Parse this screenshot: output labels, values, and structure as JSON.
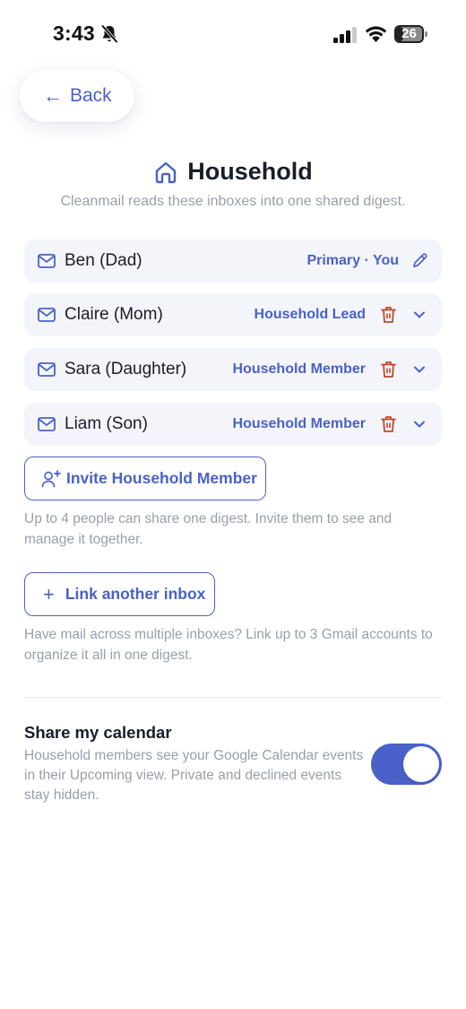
{
  "status_bar": {
    "time": "3:43",
    "battery_level": "26",
    "battery_fraction": 0.26
  },
  "nav": {
    "back_label": "Back",
    "back_arrow": "←"
  },
  "header": {
    "title": "Household",
    "subtitle": "Cleanmail reads these inboxes into one shared digest.",
    "icon": "home-icon"
  },
  "members": [
    {
      "name": "Ben (Dad)",
      "role": "Primary · You",
      "action": "edit"
    },
    {
      "name": "Claire (Mom)",
      "role": "Household Lead",
      "action": "remove"
    },
    {
      "name": "Sara (Daughter)",
      "role": "Household Member",
      "action": "remove"
    },
    {
      "name": "Liam (Son)",
      "role": "Household Member",
      "action": "remove"
    }
  ],
  "invite": {
    "button_label": "Invite Household Member",
    "help": "Up to 4 people can share one digest. Invite them to see and manage it together."
  },
  "link_inbox": {
    "button_label": "Link another inbox",
    "button_icon": "+",
    "help": "Have mail across multiple inboxes? Link up to 3 Gmail accounts to organize it all in one digest."
  },
  "calendar": {
    "title": "Share my calendar",
    "description": "Household members see your Google Calendar events in their Upcoming view. Private and declined events stay hidden.",
    "enabled": true
  },
  "colors": {
    "accent": "#4a61c9",
    "row_background": "#f4f5fb",
    "danger": "#c0472b",
    "muted_text": "#9a9ea9"
  }
}
